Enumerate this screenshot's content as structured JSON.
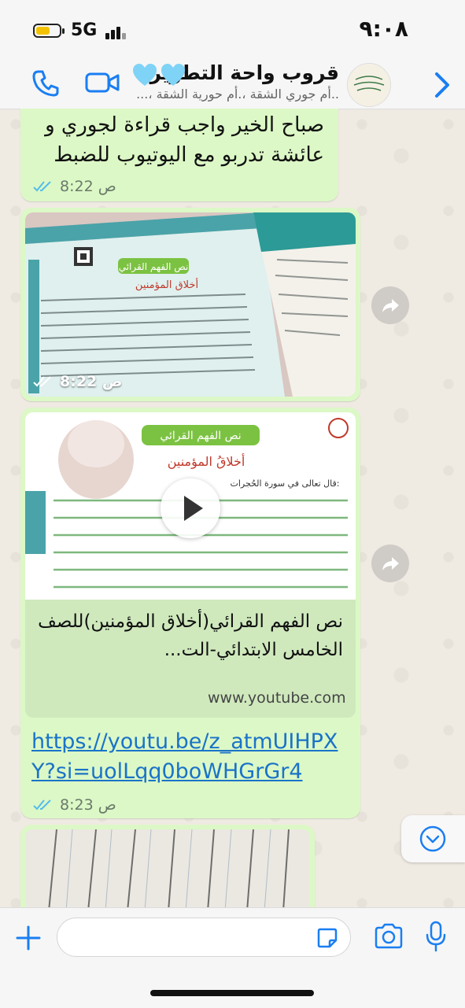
{
  "status_bar": {
    "network": "5G",
    "time": "٩:٠٨",
    "battery_level": 0.6
  },
  "header": {
    "title": "قروب واحة التطوير",
    "members": "..أم جوري الشقة ،.أم حورية الشقة ،..."
  },
  "messages": [
    {
      "type": "text",
      "text": "صباح الخير واجب قراءة لجوري و عائشة تدربو مع اليوتيوب للضبط",
      "time": "8:22 ص"
    },
    {
      "type": "image",
      "time": "8:22 ص"
    },
    {
      "type": "link",
      "preview_title": "نص الفهم القرائي(أخلاق المؤمنين)للصف الخامس الابتدائي-الت...",
      "preview_domain": "www.youtube.com",
      "url": "https://youtu.be/z_atmUIHPXY?si=uolLqq0boWHGrGr4",
      "time": "8:23 ص"
    },
    {
      "type": "image"
    }
  ],
  "thumbnail": {
    "header": "نص الفهم القرائي",
    "title": "أخلاقُ المؤمنين",
    "subtitle": "قال تعالى في سورة الحُجرات:"
  },
  "photo1": {
    "header": "نص الفهم القرائي",
    "title": "أخلاق المؤمنين"
  },
  "composer": {
    "placeholder": ""
  },
  "colors": {
    "bubble": "#dcf8c6",
    "accent": "#1a7ef2",
    "link": "#1a73c8",
    "ticks": "#53bdeb"
  },
  "icons": [
    "back-chevron-icon",
    "video-call-icon",
    "phone-call-icon",
    "forward-icon",
    "chevron-down-icon",
    "plus-icon",
    "sticker-icon",
    "camera-icon",
    "microphone-icon",
    "play-icon",
    "blue-heart-icon"
  ]
}
